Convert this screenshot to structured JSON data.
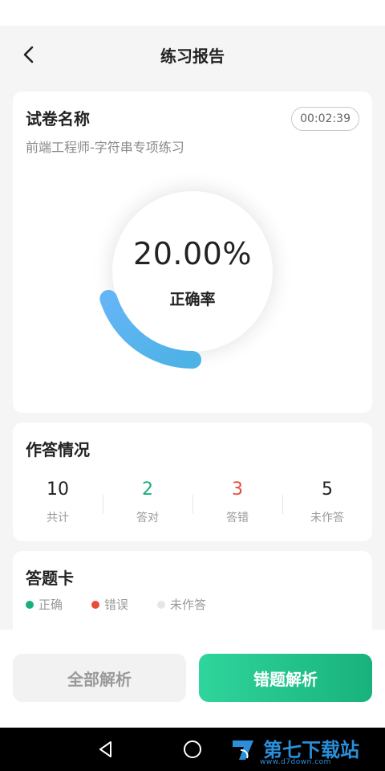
{
  "nav": {
    "title": "练习报告",
    "back_icon": "chevron-left-icon"
  },
  "paper": {
    "label": "试卷名称",
    "name": "前端工程师-字符串专项练习",
    "timer": "00:02:39",
    "accuracy": {
      "value_text": "20.00%",
      "label": "正确率",
      "fraction": 0.2
    },
    "colors": {
      "arc_start": "#64b5f6",
      "arc_end": "#4db2e5"
    }
  },
  "answers": {
    "title": "作答情况",
    "stats": [
      {
        "value": "10",
        "label": "共计",
        "color": "#222222"
      },
      {
        "value": "2",
        "label": "答对",
        "color": "#1aae78"
      },
      {
        "value": "3",
        "label": "答错",
        "color": "#e84b3c"
      },
      {
        "value": "5",
        "label": "未作答",
        "color": "#222222"
      }
    ]
  },
  "answer_sheet": {
    "title": "答题卡",
    "legend": [
      {
        "label": "正确",
        "color": "#1aae78"
      },
      {
        "label": "错误",
        "color": "#e84b3c"
      },
      {
        "label": "未作答",
        "color": "#e6e6e6"
      }
    ]
  },
  "actions": {
    "all_analysis": "全部解析",
    "wrong_analysis": "错题解析"
  },
  "system_nav": {
    "back_icon": "triangle-back-icon",
    "home_icon": "circle-home-icon",
    "watermark_text": "第七下载站",
    "watermark_sub": "www.d7down.com"
  }
}
